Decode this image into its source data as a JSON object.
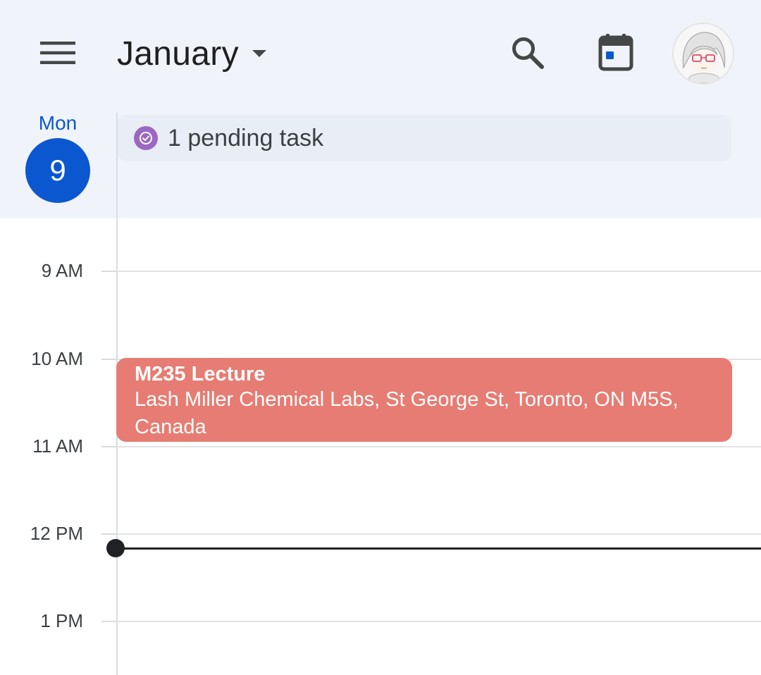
{
  "header": {
    "month": "January",
    "icons": {
      "menu": "hamburger-menu-icon",
      "caret": "caret-down-icon",
      "search": "search-icon",
      "today": "calendar-today-icon",
      "avatar": "user-avatar"
    }
  },
  "day": {
    "weekday": "Mon",
    "date": "9"
  },
  "tasks": {
    "label": "1 pending task"
  },
  "hours": [
    "9 AM",
    "10 AM",
    "11 AM",
    "12 PM",
    "1 PM"
  ],
  "events": [
    {
      "title": "M235 Lecture",
      "location": "Lash Miller Chemical Labs, St George St, Toronto, ON M5S, Canada",
      "color": "#e67c73"
    }
  ],
  "colors": {
    "accent": "#0b57d0",
    "header_bg": "#f0f4fa",
    "task_icon": "#9c67c2",
    "now_indicator": "#202124"
  }
}
